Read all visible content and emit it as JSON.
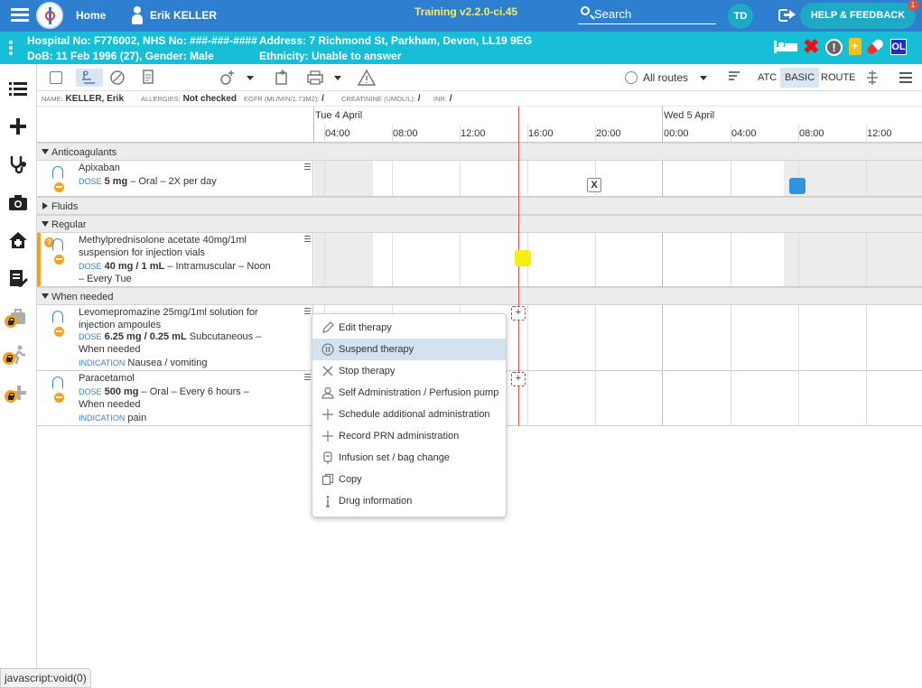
{
  "topbar": {
    "home_label": "Home",
    "patient_name": "Erik KELLER",
    "training": "Training v2.2.0-ci.45",
    "search_placeholder": "Search",
    "user_initials": "TD",
    "help_label": "HELP & FEEDBACK",
    "notification_count": "1",
    "colors": {
      "topbar": "#2f7fd1",
      "patient_bar": "#16bfd6"
    }
  },
  "patient_bar": {
    "hospital_no": "Hospital No: F776002, NHS No: ###-###-####",
    "address": "Address: 7 Richmond St, Parkham, Devon, LL19 9EG",
    "dob": "DoB: 11 Feb 1996 (27), Gender: Male",
    "ethnicity": "Ethnicity: Unable to answer",
    "ol_badge": "OL"
  },
  "toolbar": {
    "routes_label": "All routes",
    "atc_label": "ATC",
    "basic_label": "BASIC",
    "route_label": "ROUTE"
  },
  "info_line": {
    "name_label": "NAME:",
    "name_value": "KELLER, Erik",
    "allergies_label": "ALLERGIES:",
    "allergies_value": "Not checked",
    "egfr_label": "EGFR (ML/MIN/1.73M2):",
    "egfr_value": "/",
    "creatinine_label": "CREATININE (UMOL/L):",
    "creatinine_value": "/",
    "inr_label": "INR:",
    "inr_value": "/"
  },
  "timeline": {
    "days": [
      "Tue 4 April",
      "Wed 5 April"
    ],
    "hours": [
      "04:00",
      "08:00",
      "12:00",
      "16:00",
      "20:00",
      "00:00",
      "04:00",
      "08:00",
      "12:00"
    ]
  },
  "sections": {
    "anticoagulants": "Anticoagulants",
    "fluids": "Fluids",
    "regular": "Regular",
    "when_needed": "When needed"
  },
  "drugs": {
    "apixaban": {
      "name": "Apixaban",
      "dose_label": "DOSE",
      "dose_value": "5 mg",
      "dose_rest": " – Oral – 2X per day"
    },
    "methylpred": {
      "name": "Methylprednisolone acetate 40mg/1ml suspension for injection vials",
      "dose_label": "DOSE",
      "dose_value": "40 mg / 1 mL",
      "dose_rest": " – Intramuscular – Noon – Every Tue"
    },
    "levomepromazine": {
      "name": "Levomepromazine 25mg/1ml solution for injection ampoules",
      "dose_label": "DOSE",
      "dose_value": "6.25 mg / 0.25 mL",
      "dose_rest": " Subcutaneous – When needed",
      "indication_label": "INDICATION",
      "indication_value": "Nausea / vomiting"
    },
    "paracetamol": {
      "name": "Paracetamol",
      "dose_label": "DOSE",
      "dose_value": "500 mg",
      "dose_rest": " – Oral – Every 6 hours – When needed",
      "indication_label": "INDICATION",
      "indication_value": "pain"
    }
  },
  "grid_marks": {
    "skipped_symbol": "X",
    "add_symbol": "+"
  },
  "context_menu": {
    "items": [
      {
        "label": "Edit therapy",
        "icon": "pencil-icon"
      },
      {
        "label": "Suspend therapy",
        "icon": "pause-icon"
      },
      {
        "label": "Stop therapy",
        "icon": "close-icon"
      },
      {
        "label": "Self Administration / Perfusion pump",
        "icon": "person-icon"
      },
      {
        "label": "Schedule additional administration",
        "icon": "plus-icon"
      },
      {
        "label": "Record PRN administration",
        "icon": "plus-icon"
      },
      {
        "label": "Infusion set / bag change",
        "icon": "infusion-bag-icon"
      },
      {
        "label": "Copy",
        "icon": "copy-icon"
      },
      {
        "label": "Drug information",
        "icon": "info-icon"
      }
    ],
    "highlighted": "Suspend therapy"
  },
  "status_bar": {
    "text": "javascript:void(0)"
  }
}
